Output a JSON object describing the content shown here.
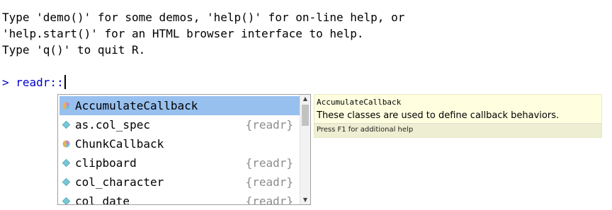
{
  "console": {
    "lines": [
      "Type 'demo()' for some demos, 'help()' for on-line help, or",
      "'help.start()' for an HTML browser interface to help.",
      "Type 'q()' to quit R."
    ],
    "prompt": "> readr::"
  },
  "completion": {
    "items": [
      {
        "name": "AccumulateCallback",
        "pkg": "",
        "icon": "r6-class-icon",
        "selected": true
      },
      {
        "name": "as.col_spec",
        "pkg": "{readr}",
        "icon": "function-icon",
        "selected": false
      },
      {
        "name": "ChunkCallback",
        "pkg": "",
        "icon": "r6-class-icon",
        "selected": false
      },
      {
        "name": "clipboard",
        "pkg": "{readr}",
        "icon": "function-icon",
        "selected": false
      },
      {
        "name": "col_character",
        "pkg": "{readr}",
        "icon": "function-icon",
        "selected": false
      },
      {
        "name": "col_date",
        "pkg": "{readr}",
        "icon": "function-icon",
        "selected": false
      }
    ]
  },
  "help": {
    "title": "AccumulateCallback",
    "description": "These classes are used to define callback behaviors.",
    "footer": "Press F1 for additional help"
  },
  "colors": {
    "prompt": "#0000cc",
    "selection": "#97c0ef",
    "tooltip_bg": "#ffffe0",
    "function_icon": "#79c6d4"
  }
}
